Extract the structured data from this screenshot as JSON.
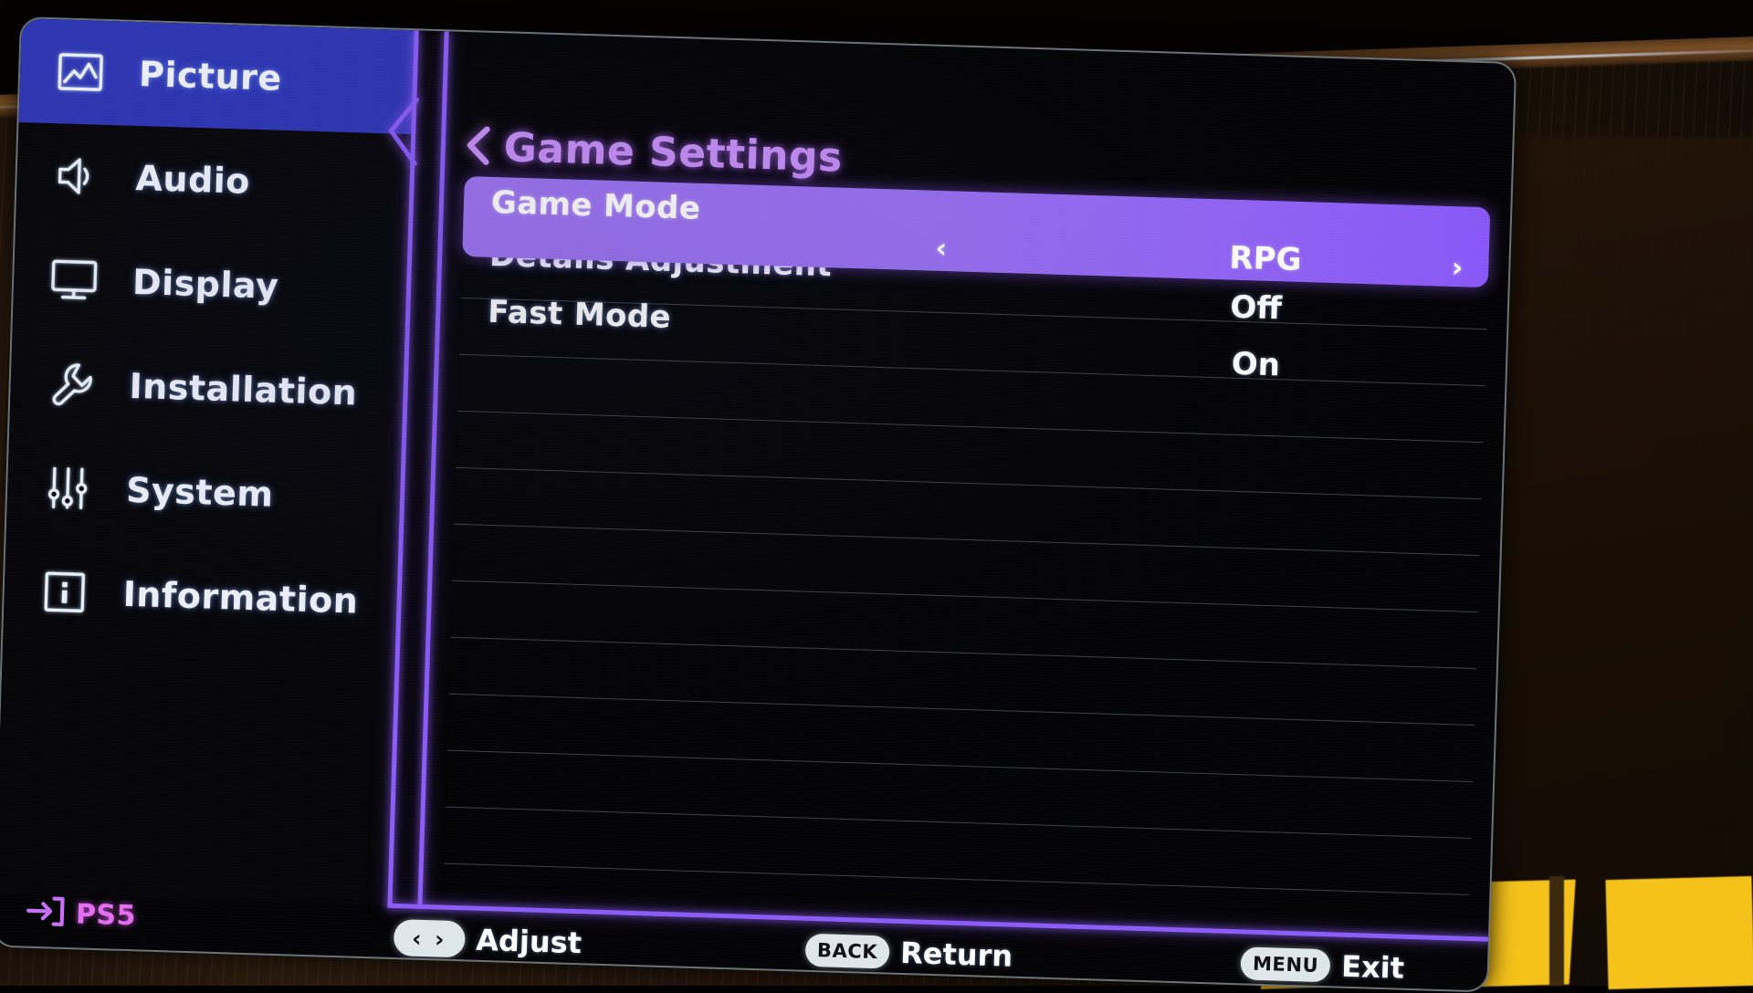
{
  "device": {
    "osd_title": "Game Settings",
    "source_label": "PS5"
  },
  "sidebar": {
    "items": [
      {
        "label": "Picture",
        "icon": "picture-icon",
        "active": true
      },
      {
        "label": "Audio",
        "icon": "speaker-icon",
        "active": false
      },
      {
        "label": "Display",
        "icon": "monitor-icon",
        "active": false
      },
      {
        "label": "Installation",
        "icon": "wrench-icon",
        "active": false
      },
      {
        "label": "System",
        "icon": "sliders-icon",
        "active": false
      },
      {
        "label": "Information",
        "icon": "info-square-icon",
        "active": false
      }
    ]
  },
  "main": {
    "back_icon": "chevron-left-icon",
    "selected": {
      "label": "Game Mode",
      "value": "RPG",
      "left_arrow": "‹",
      "right_arrow": "›"
    },
    "rows": [
      {
        "label": "Details Adjustment",
        "value": "Off"
      },
      {
        "label": "Fast Mode",
        "value": "On"
      }
    ],
    "empty_row_count": 9
  },
  "hints": [
    {
      "key": "‹ ›",
      "key_type": "arrows",
      "text": "Adjust",
      "name": "hint-adjust"
    },
    {
      "key": "BACK",
      "key_type": "word",
      "text": "Return",
      "name": "hint-return"
    },
    {
      "key": "MENU",
      "key_type": "word",
      "text": "Exit",
      "name": "hint-exit"
    }
  ],
  "colors": {
    "active_nav": "#2f36b4",
    "accent_purple": "#8b5cf6",
    "highlight_start": "#9c74f0",
    "highlight_end": "#8a57f6",
    "title_purple": "#c58ff5",
    "source_magenta": "#e36ff0",
    "separator": "#a8c4c4"
  }
}
